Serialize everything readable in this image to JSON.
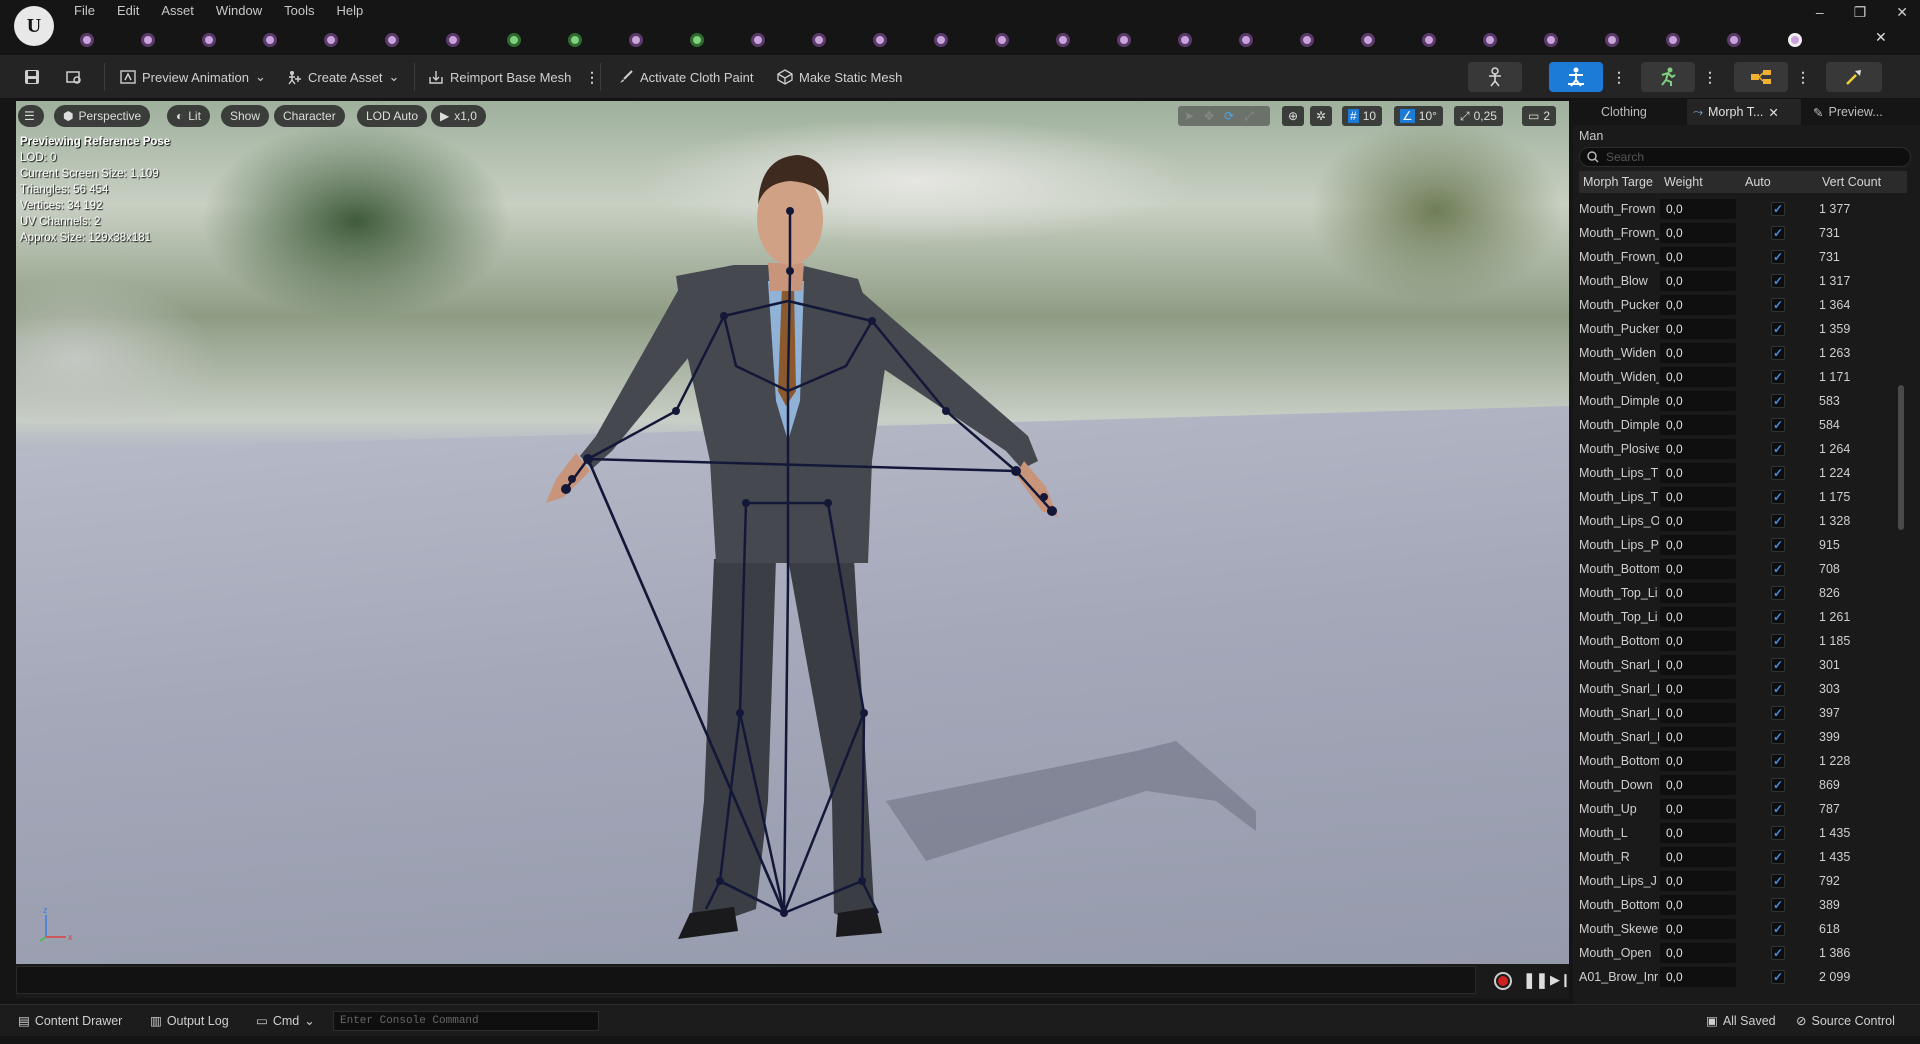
{
  "menu": [
    "File",
    "Edit",
    "Asset",
    "Window",
    "Tools",
    "Help"
  ],
  "logo": "U",
  "window_buttons": {
    "minimize": "–",
    "restore": "❐",
    "close": "✕"
  },
  "toolbar": {
    "preview_animation": "Preview Animation",
    "create_asset": "Create Asset",
    "reimport_base_mesh": "Reimport Base Mesh",
    "activate_cloth_paint": "Activate Cloth Paint",
    "make_static_mesh": "Make Static Mesh"
  },
  "viewport": {
    "perspective": "Perspective",
    "lit": "Lit",
    "show": "Show",
    "character": "Character",
    "lod": "LOD Auto",
    "play_rate": "x1,0",
    "grid_snap": "10",
    "rot_snap": "10°",
    "scale_snap": "0,25",
    "cam_speed": "2",
    "stats": [
      "Previewing Reference Pose",
      "LOD: 0",
      "Current Screen Size: 1,109",
      "Triangles: 56 454",
      "Vertices: 34 192",
      "UV Channels: 2",
      "Approx Size: 129x38x181"
    ],
    "axis_x": "x",
    "axis_z": "z"
  },
  "statusbar": {
    "content_drawer": "Content Drawer",
    "output_log": "Output Log",
    "cmd": "Cmd",
    "console_placeholder": "Enter Console Command",
    "all_saved": "All Saved",
    "source_control": "Source Control"
  },
  "panel": {
    "tabs": [
      "Clothing",
      "Morph T...",
      "Preview..."
    ],
    "mesh_name": "Man",
    "search_placeholder": "Search",
    "columns": [
      "Morph Targe",
      "Weight",
      "Auto",
      "Vert Count"
    ],
    "rows": [
      {
        "name": "Mouth_Frown",
        "weight": "0,0",
        "auto": true,
        "count": "1 377"
      },
      {
        "name": "Mouth_Frown_",
        "weight": "0,0",
        "auto": true,
        "count": "731"
      },
      {
        "name": "Mouth_Frown_",
        "weight": "0,0",
        "auto": true,
        "count": "731"
      },
      {
        "name": "Mouth_Blow",
        "weight": "0,0",
        "auto": true,
        "count": "1 317"
      },
      {
        "name": "Mouth_Pucker",
        "weight": "0,0",
        "auto": true,
        "count": "1 364"
      },
      {
        "name": "Mouth_Pucker",
        "weight": "0,0",
        "auto": true,
        "count": "1 359"
      },
      {
        "name": "Mouth_Widen",
        "weight": "0,0",
        "auto": true,
        "count": "1 263"
      },
      {
        "name": "Mouth_Widen_",
        "weight": "0,0",
        "auto": true,
        "count": "1 171"
      },
      {
        "name": "Mouth_Dimple",
        "weight": "0,0",
        "auto": true,
        "count": "583"
      },
      {
        "name": "Mouth_Dimple",
        "weight": "0,0",
        "auto": true,
        "count": "584"
      },
      {
        "name": "Mouth_Plosive",
        "weight": "0,0",
        "auto": true,
        "count": "1 264"
      },
      {
        "name": "Mouth_Lips_T",
        "weight": "0,0",
        "auto": true,
        "count": "1 224"
      },
      {
        "name": "Mouth_Lips_T",
        "weight": "0,0",
        "auto": true,
        "count": "1 175"
      },
      {
        "name": "Mouth_Lips_O",
        "weight": "0,0",
        "auto": true,
        "count": "1 328"
      },
      {
        "name": "Mouth_Lips_P",
        "weight": "0,0",
        "auto": true,
        "count": "915"
      },
      {
        "name": "Mouth_Bottom",
        "weight": "0,0",
        "auto": true,
        "count": "708"
      },
      {
        "name": "Mouth_Top_Li",
        "weight": "0,0",
        "auto": true,
        "count": "826"
      },
      {
        "name": "Mouth_Top_Li",
        "weight": "0,0",
        "auto": true,
        "count": "1 261"
      },
      {
        "name": "Mouth_Bottom",
        "weight": "0,0",
        "auto": true,
        "count": "1 185"
      },
      {
        "name": "Mouth_Snarl_I",
        "weight": "0,0",
        "auto": true,
        "count": "301"
      },
      {
        "name": "Mouth_Snarl_I",
        "weight": "0,0",
        "auto": true,
        "count": "303"
      },
      {
        "name": "Mouth_Snarl_I",
        "weight": "0,0",
        "auto": true,
        "count": "397"
      },
      {
        "name": "Mouth_Snarl_I",
        "weight": "0,0",
        "auto": true,
        "count": "399"
      },
      {
        "name": "Mouth_Bottom",
        "weight": "0,0",
        "auto": true,
        "count": "1 228"
      },
      {
        "name": "Mouth_Down",
        "weight": "0,0",
        "auto": true,
        "count": "869"
      },
      {
        "name": "Mouth_Up",
        "weight": "0,0",
        "auto": true,
        "count": "787"
      },
      {
        "name": "Mouth_L",
        "weight": "0,0",
        "auto": true,
        "count": "1 435"
      },
      {
        "name": "Mouth_R",
        "weight": "0,0",
        "auto": true,
        "count": "1 435"
      },
      {
        "name": "Mouth_Lips_J",
        "weight": "0,0",
        "auto": true,
        "count": "792"
      },
      {
        "name": "Mouth_Bottom",
        "weight": "0,0",
        "auto": true,
        "count": "389"
      },
      {
        "name": "Mouth_Skewe",
        "weight": "0,0",
        "auto": true,
        "count": "618"
      },
      {
        "name": "Mouth_Open",
        "weight": "0,0",
        "auto": true,
        "count": "1 386"
      },
      {
        "name": "A01_Brow_Inr",
        "weight": "0,0",
        "auto": true,
        "count": "2 099"
      }
    ]
  },
  "colors": {
    "accent": "#1d7bd8",
    "check": "#3a8ee6",
    "bone": "#141838"
  }
}
